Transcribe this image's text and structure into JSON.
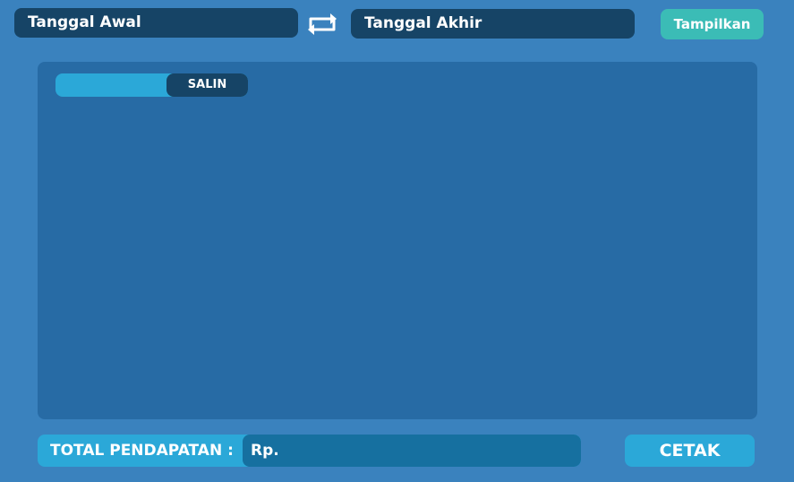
{
  "filters": {
    "start_date_placeholder": "Tanggal Awal",
    "end_date_placeholder": "Tanggal Akhir",
    "swap_icon": "swap-arrows-icon",
    "show_label": "Tampilkan"
  },
  "report": {
    "copy_label": "SALIN"
  },
  "summary": {
    "total_label": "TOTAL PENDAPATAN :",
    "total_value": "Rp.",
    "print_label": "CETAK"
  },
  "colors": {
    "background": "#3a82be",
    "field_dark": "#164466",
    "panel": "#276ba5",
    "accent_cyan": "#2ba8d8",
    "accent_teal": "#3bbcb6"
  }
}
